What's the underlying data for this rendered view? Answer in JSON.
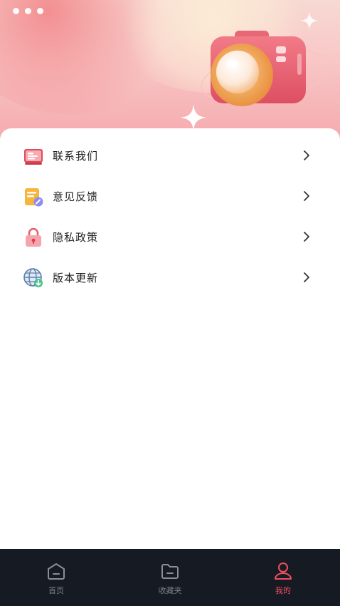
{
  "menu": {
    "items": [
      {
        "label": "联系我们",
        "icon": "contact-card-icon"
      },
      {
        "label": "意见反馈",
        "icon": "feedback-icon"
      },
      {
        "label": "隐私政策",
        "icon": "lock-icon"
      },
      {
        "label": "版本更新",
        "icon": "globe-update-icon"
      }
    ]
  },
  "tabbar": {
    "tabs": [
      {
        "label": "首页",
        "icon": "home-icon",
        "active": false
      },
      {
        "label": "收藏夹",
        "icon": "folder-icon",
        "active": false
      },
      {
        "label": "我的",
        "icon": "user-icon",
        "active": true
      }
    ]
  },
  "colors": {
    "accent": "#ef4e5f",
    "tabbar_bg": "#161a22",
    "tab_inactive": "#7b7f88",
    "header_pink": "#f5a9ad"
  }
}
